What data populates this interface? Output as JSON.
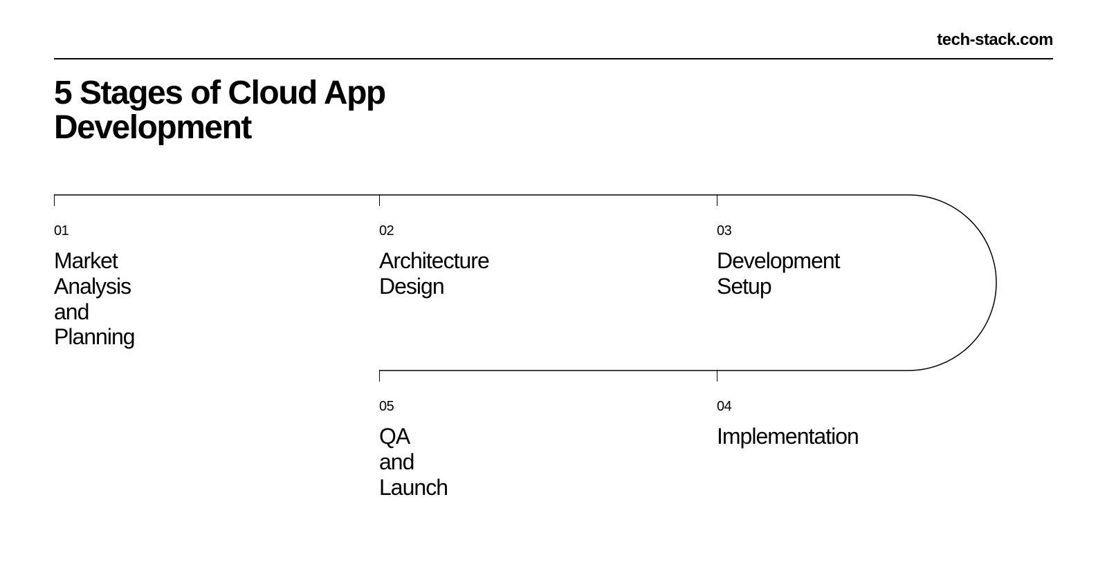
{
  "brand": "tech-stack.com",
  "title": "5 Stages of Cloud App\nDevelopment",
  "stages": [
    {
      "num": "01",
      "label": "Market Analysis\nand Planning"
    },
    {
      "num": "02",
      "label": "Architecture\nDesign"
    },
    {
      "num": "03",
      "label": "Development\nSetup"
    },
    {
      "num": "04",
      "label": "Implementation"
    },
    {
      "num": "05",
      "label": "QA and Launch"
    }
  ]
}
